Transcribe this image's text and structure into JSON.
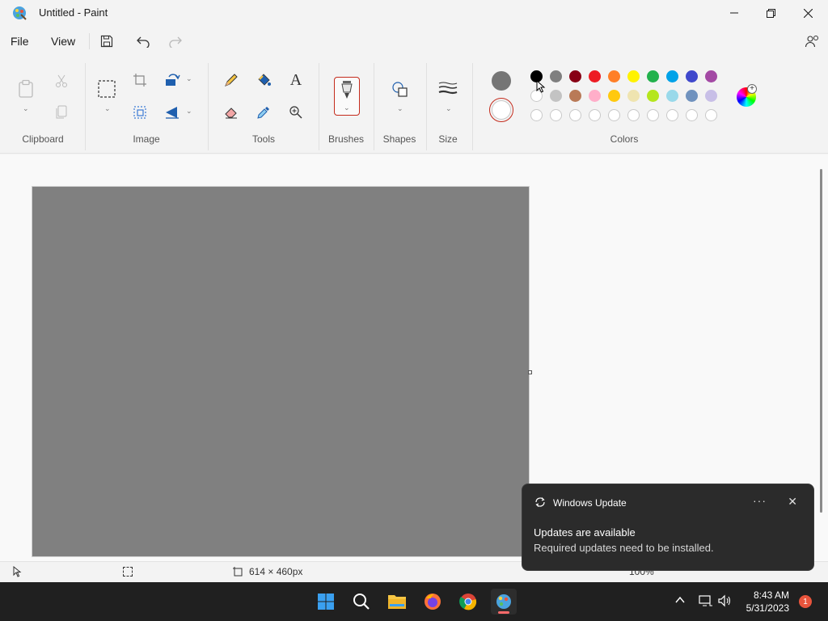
{
  "window": {
    "title": "Untitled - Paint"
  },
  "menu": {
    "file": "File",
    "view": "View"
  },
  "ribbon": {
    "groups": {
      "clipboard": "Clipboard",
      "image": "Image",
      "tools": "Tools",
      "brushes": "Brushes",
      "shapes": "Shapes",
      "size": "Size",
      "colors": "Colors"
    },
    "tool_text_glyph": "A"
  },
  "colors": {
    "primary": "#757575",
    "secondary": "#ffffff",
    "palette_row1": [
      "#000000",
      "#7f7f7f",
      "#880015",
      "#ed1c24",
      "#ff7f27",
      "#fff200",
      "#22b14c",
      "#00a2e8",
      "#3f48cc",
      "#a349a4"
    ],
    "palette_row2": [
      "#ffffff",
      "#c3c3c3",
      "#b97a57",
      "#ffaec9",
      "#ffc90e",
      "#efe4b0",
      "#b5e61d",
      "#99d9ea",
      "#7092be",
      "#c8bfe7"
    ],
    "palette_row3_empty_count": 10
  },
  "canvas": {
    "background": "#808080"
  },
  "status": {
    "canvas_size": "614 × 460px",
    "zoom": "100%"
  },
  "toast": {
    "app": "Windows Update",
    "title": "Updates are available",
    "body": "Required updates need to be installed.",
    "more": "···",
    "close": "✕"
  },
  "taskbar": {
    "time": "8:43 AM",
    "date": "5/31/2023",
    "notification_count": "1",
    "apps": [
      "start-icon",
      "search-icon",
      "file-explorer-icon",
      "firefox-icon",
      "chrome-icon",
      "paint-icon"
    ]
  }
}
